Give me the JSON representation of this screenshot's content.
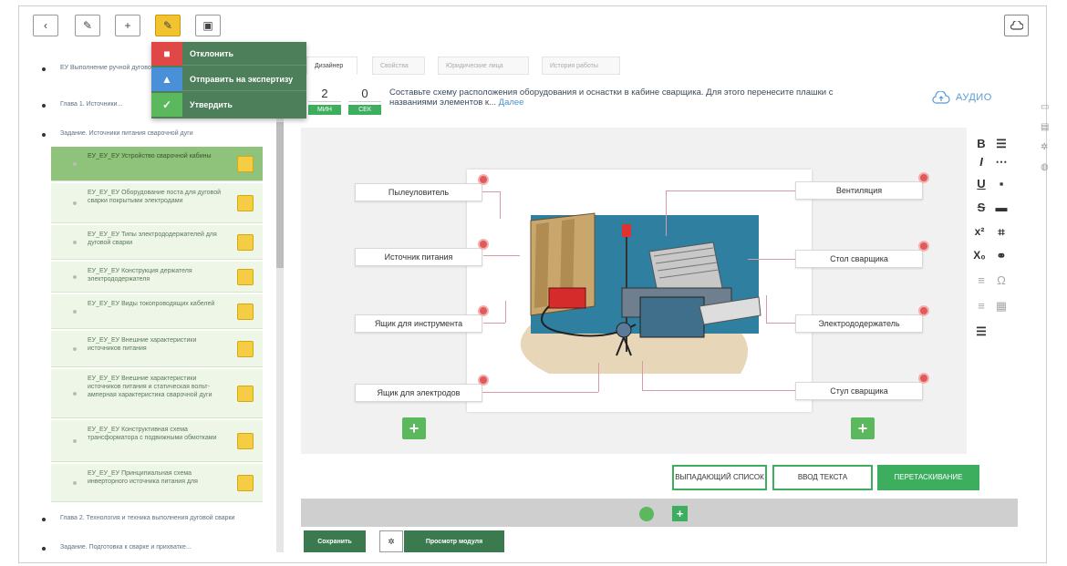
{
  "toolbar": {
    "buttons": [
      "back-icon",
      "edit-icon",
      "add-icon",
      "status-icon",
      "video-icon"
    ]
  },
  "status_menu": {
    "items": [
      {
        "label": "Отклонить",
        "color": "#e04848",
        "icon": "close-icon"
      },
      {
        "label": "Отправить на экспертизу",
        "color": "#4a90d9",
        "icon": "upload-icon"
      },
      {
        "label": "Утвердить",
        "color": "#5cb85c",
        "icon": "check-icon"
      }
    ]
  },
  "tree": {
    "root": "ЕУ Выполнение ручной дуговой сварки, резки деталей...",
    "chapter1": "Глава 1. Источники...",
    "section": "Задание. Источники питания сварочной дуги",
    "lessons": [
      "ЕУ_ЕУ_ЕУ Устройство сварочной кабины",
      "ЕУ_ЕУ_ЕУ Оборудование поста для дуговой сварки покрытыми электродами",
      "ЕУ_ЕУ_ЕУ Типы электрододержателей для дуговой сварки",
      "ЕУ_ЕУ_ЕУ Конструкция держателя электрододержателя",
      "ЕУ_ЕУ_ЕУ Виды токопроводящих кабелей",
      "ЕУ_ЕУ_ЕУ Внешние характеристики источников питания",
      "ЕУ_ЕУ_ЕУ Внешние характеристики источников питания и статическая вольт-амперная характеристика сварочной дуги",
      "ЕУ_ЕУ_ЕУ Конструктивная схема трансформатора с подвижными обмотками",
      "ЕУ_ЕУ_ЕУ Принципиальная схема инверторного источника питания для"
    ],
    "chapter2": "Глава 2. Технология и техника выполнения дуговой сварки",
    "chapter3": "Задание. Подготовка к сварке и прихватке..."
  },
  "tabs": [
    "Дизайнер",
    "Свойства",
    "Юридические лица",
    "История работы"
  ],
  "timer": {
    "minutes": "2",
    "minutes_label": "МИН",
    "seconds": "0",
    "seconds_label": "СЕК"
  },
  "task": {
    "text": "Составьте схему расположения оборудования и оснастки в кабине сварщика. Для этого перенесите плашки с названиями элементов к...",
    "more": "Далее"
  },
  "audio_label": "АУДИО",
  "labels_left": [
    "Пылеуловитель",
    "Источник питания",
    "Ящик для инструмента",
    "Ящик для электродов"
  ],
  "labels_right": [
    "Вентиляция",
    "Стол сварщика",
    "Электрододержатель",
    "Стул сварщика"
  ],
  "modes": {
    "dropdown": "ВЫПАДАЮЩИЙ СПИСОК",
    "text_input": "ВВОД ТЕКСТА",
    "drag": "ПЕРЕТАСКИВАНИЕ"
  },
  "footer": {
    "save": "Сохранить",
    "preview": "Просмотр модуля"
  },
  "colors": {
    "accent": "#3cae5e",
    "delete": "#e05a5a",
    "link": "#4a8fd4"
  }
}
